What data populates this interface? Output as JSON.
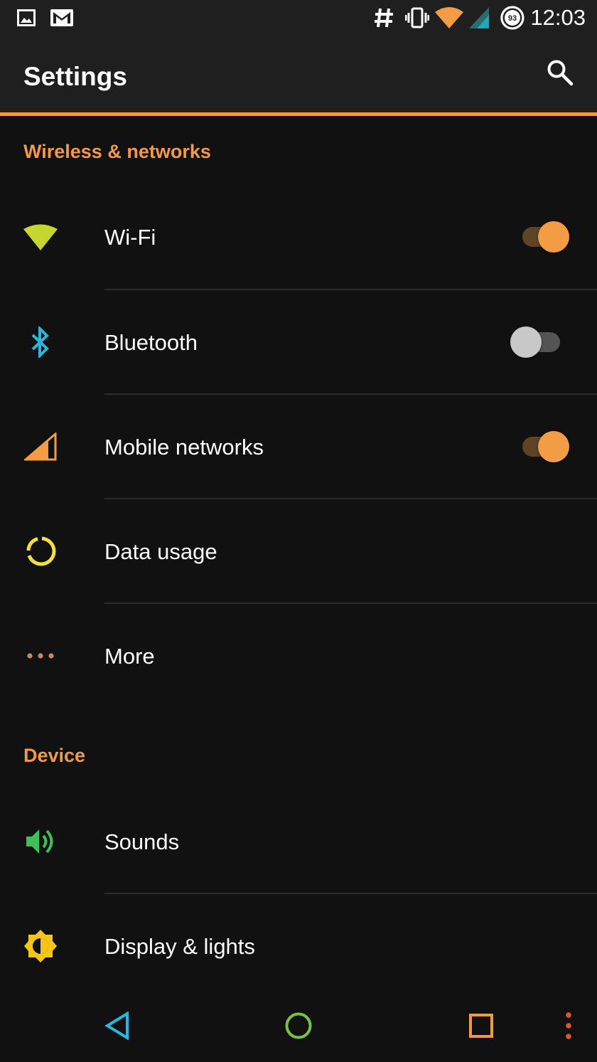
{
  "status_bar": {
    "time": "12:03",
    "battery_level": "93",
    "icons": [
      "image-icon",
      "gmail-icon",
      "hash-icon",
      "vibrate-icon",
      "wifi-icon",
      "cell-signal-icon",
      "battery-icon"
    ]
  },
  "toolbar": {
    "title": "Settings",
    "search_icon": "search-icon"
  },
  "sections": [
    {
      "header": "Wireless & networks",
      "items": [
        {
          "label": "Wi-Fi",
          "icon": "wifi-icon",
          "toggle": true,
          "color": "#c6d62e"
        },
        {
          "label": "Bluetooth",
          "icon": "bluetooth-icon",
          "toggle": false,
          "color": "#29b6d8"
        },
        {
          "label": "Mobile networks",
          "icon": "cell-signal-icon",
          "toggle": true,
          "color": "#f29d45"
        },
        {
          "label": "Data usage",
          "icon": "data-usage-icon",
          "color": "#f5e03a"
        },
        {
          "label": "More",
          "icon": "more-dots-icon",
          "color": "#c98a5a"
        }
      ]
    },
    {
      "header": "Device",
      "items": [
        {
          "label": "Sounds",
          "icon": "volume-icon",
          "color": "#3fbf5a"
        },
        {
          "label": "Display & lights",
          "icon": "brightness-icon",
          "color": "#f5c518"
        }
      ]
    }
  ],
  "nav_bar": {
    "buttons": [
      "back-icon",
      "home-icon",
      "recents-icon",
      "menu-dots-icon"
    ]
  },
  "colors": {
    "accent": "#f29d33",
    "section_header": "#f2994a",
    "background": "#111111",
    "toolbar": "#1f1f1f"
  }
}
